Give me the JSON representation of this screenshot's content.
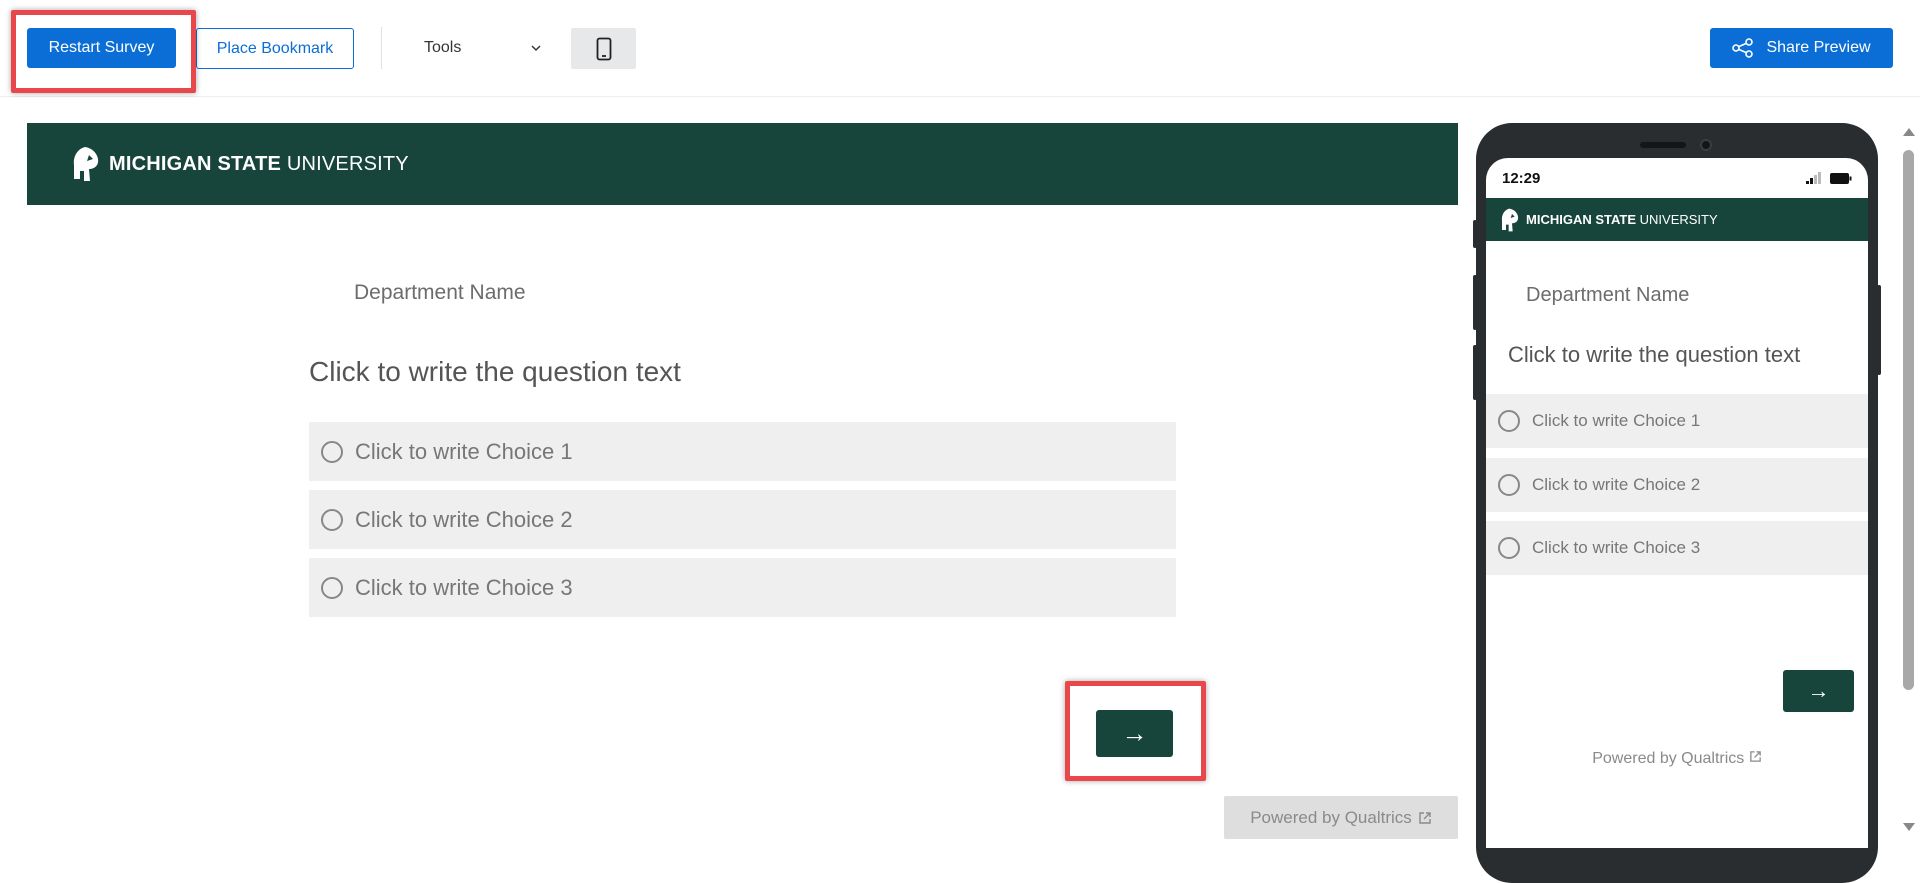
{
  "toolbar": {
    "restart_label": "Restart Survey",
    "bookmark_label": "Place Bookmark",
    "tools_label": "Tools",
    "share_label": "Share Preview"
  },
  "survey": {
    "brand_bold": "MICHIGAN STATE",
    "brand_light": "UNIVERSITY",
    "department": "Department Name",
    "question": "Click to write the question text",
    "choices": [
      "Click to write Choice 1",
      "Click to write Choice 2",
      "Click to write Choice 3"
    ],
    "next_label": "→",
    "powered_by": "Powered by Qualtrics"
  },
  "mobile": {
    "time": "12:29",
    "brand_bold": "MICHIGAN STATE",
    "brand_light": "UNIVERSITY",
    "department": "Department Name",
    "question": "Click to write the question text",
    "choices": [
      "Click to write Choice 1",
      "Click to write Choice 2",
      "Click to write Choice 3"
    ],
    "next_label": "→",
    "powered_by": "Powered by Qualtrics"
  },
  "colors": {
    "primary_blue": "#0b6ed6",
    "msu_green": "#18453b",
    "highlight_red": "#e8474c",
    "choice_bg": "#efefef"
  },
  "icons": {
    "tools": "chevron-down-icon",
    "device": "mobile-phone-icon",
    "share": "share-icon",
    "logo": "spartan-helmet-icon",
    "external": "external-link-icon"
  }
}
